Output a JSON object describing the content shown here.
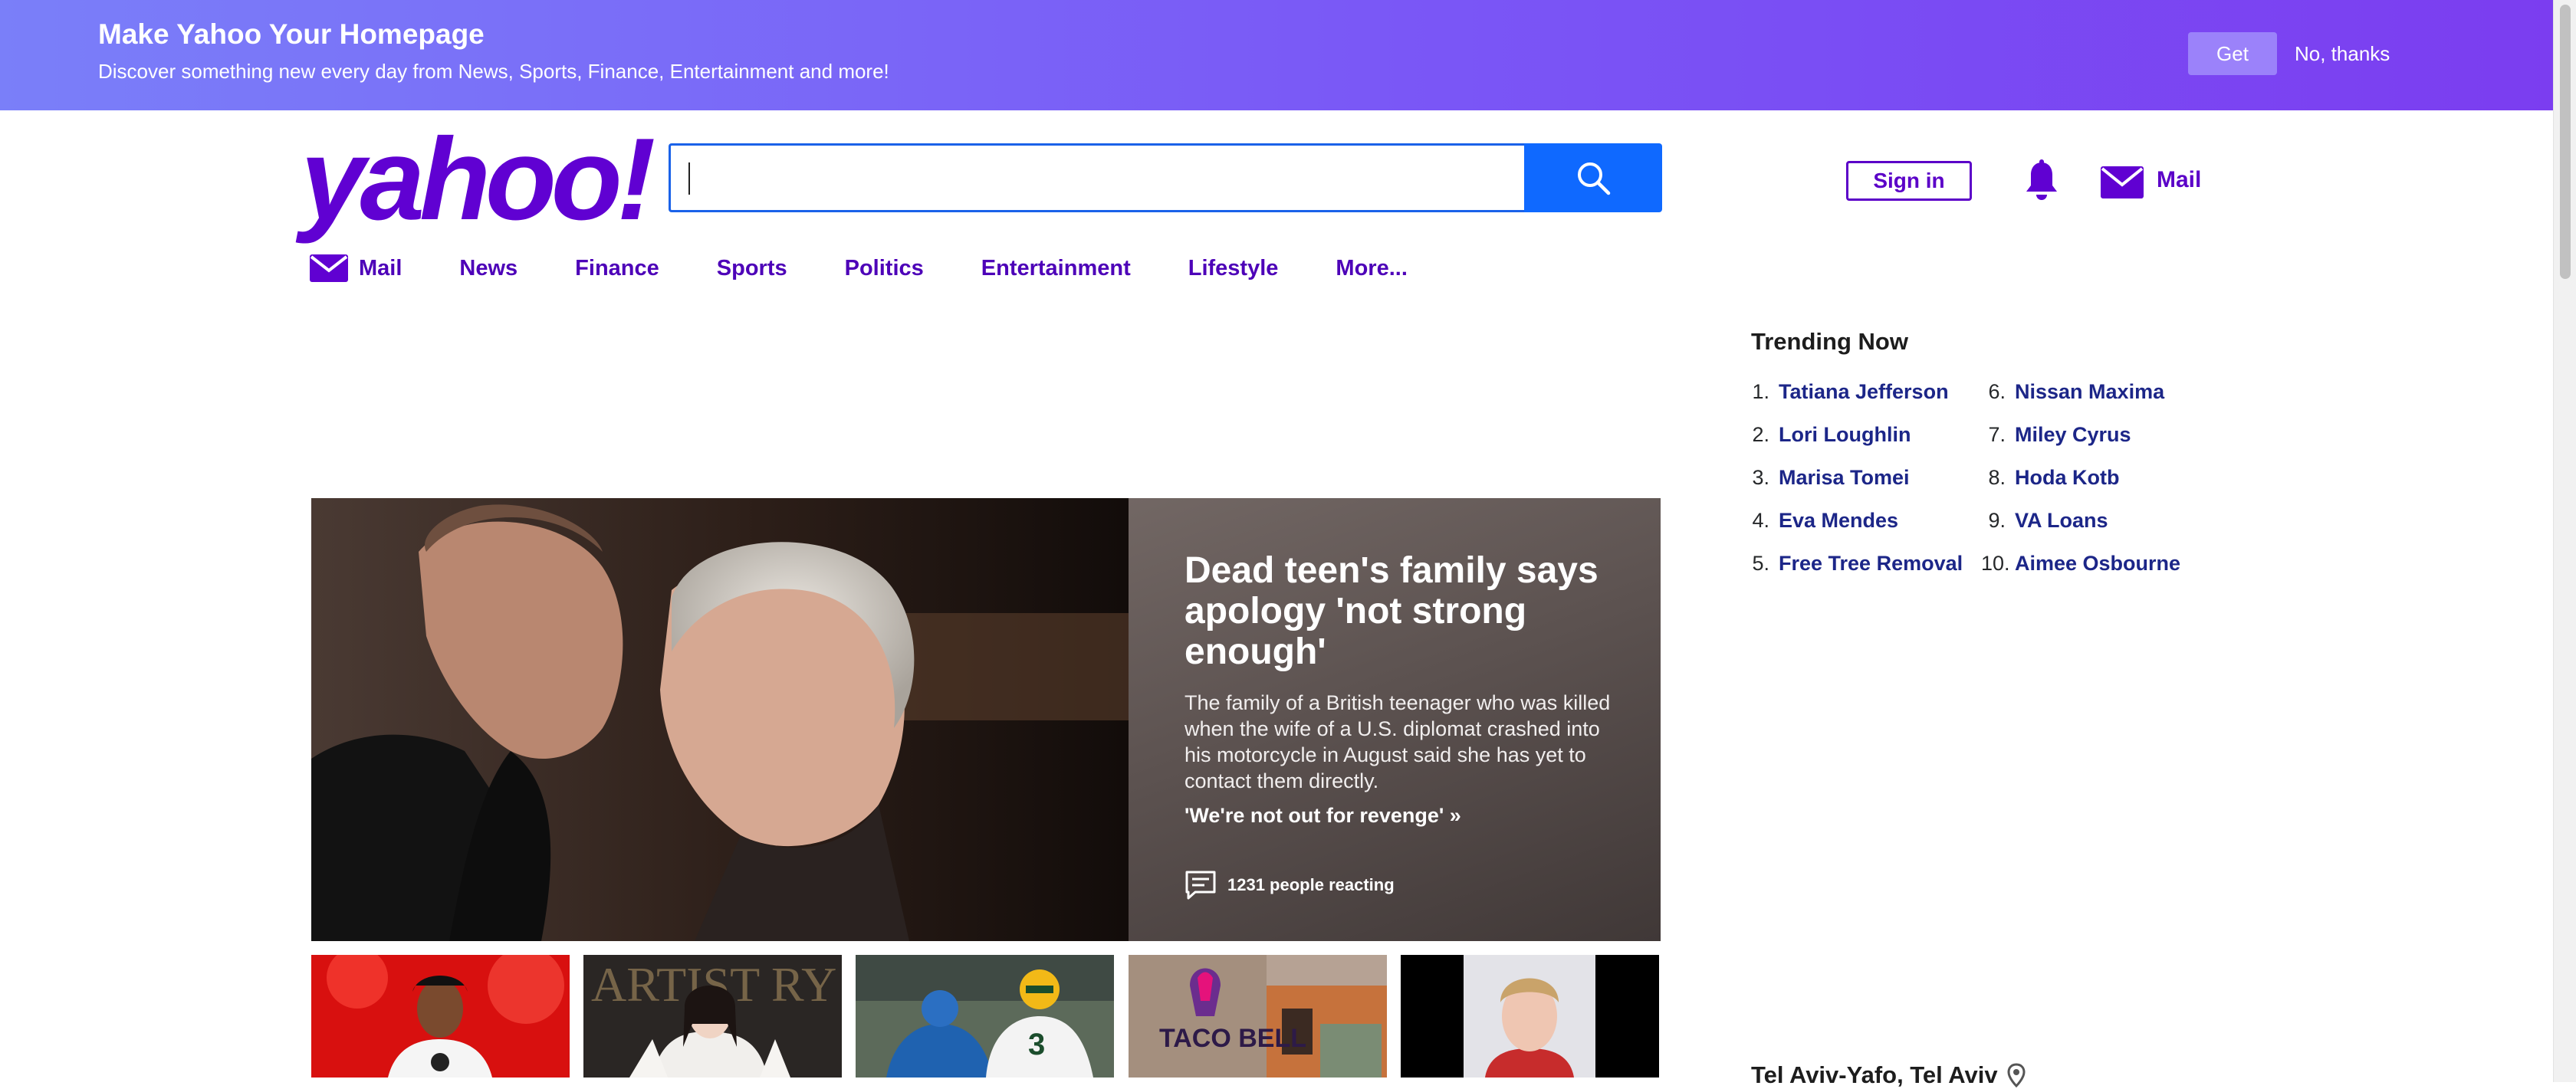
{
  "banner": {
    "title": "Make Yahoo Your Homepage",
    "subtitle": "Discover something new every day from News, Sports, Finance, Entertainment and more!",
    "get_label": "Get",
    "decline_label": "No, thanks"
  },
  "header": {
    "logo": "yahoo!",
    "search_value": "",
    "signin_label": "Sign in",
    "mail_label": "Mail"
  },
  "nav": {
    "items": [
      {
        "label": "Mail"
      },
      {
        "label": "News"
      },
      {
        "label": "Finance"
      },
      {
        "label": "Sports"
      },
      {
        "label": "Politics"
      },
      {
        "label": "Entertainment"
      },
      {
        "label": "Lifestyle"
      },
      {
        "label": "More..."
      }
    ]
  },
  "hero": {
    "title": "Dead teen's family says apology 'not strong enough'",
    "description": "The family of a British teenager who was killed when the wife of a U.S. diplomat crashed into his motorcycle in August said she has yet to contact them directly.",
    "link": "'We're not out for revenge' »",
    "reactions": "1231 people reacting"
  },
  "thumbnails": [
    {
      "icon": "celebrity-photo"
    },
    {
      "icon": "woman-photo"
    },
    {
      "icon": "football-photo"
    },
    {
      "icon": "taco-bell-photo",
      "text": "TACO BELL"
    },
    {
      "icon": "mugshot-photo"
    }
  ],
  "trending": {
    "title": "Trending Now",
    "items": [
      {
        "num": "1.",
        "name": "Tatiana Jefferson"
      },
      {
        "num": "2.",
        "name": "Lori Loughlin"
      },
      {
        "num": "3.",
        "name": "Marisa Tomei"
      },
      {
        "num": "4.",
        "name": "Eva Mendes"
      },
      {
        "num": "5.",
        "name": "Free Tree Removal"
      },
      {
        "num": "6.",
        "name": "Nissan Maxima"
      },
      {
        "num": "7.",
        "name": "Miley Cyrus"
      },
      {
        "num": "8.",
        "name": "Hoda Kotb"
      },
      {
        "num": "9.",
        "name": "VA Loans"
      },
      {
        "num": "10.",
        "name": "Aimee Osbourne"
      }
    ]
  },
  "weather": {
    "location": "Tel Aviv-Yafo, Tel Aviv"
  },
  "colors": {
    "brand_purple": "#6001d2",
    "search_blue": "#0f69ff",
    "trending_link": "#1c2688"
  }
}
